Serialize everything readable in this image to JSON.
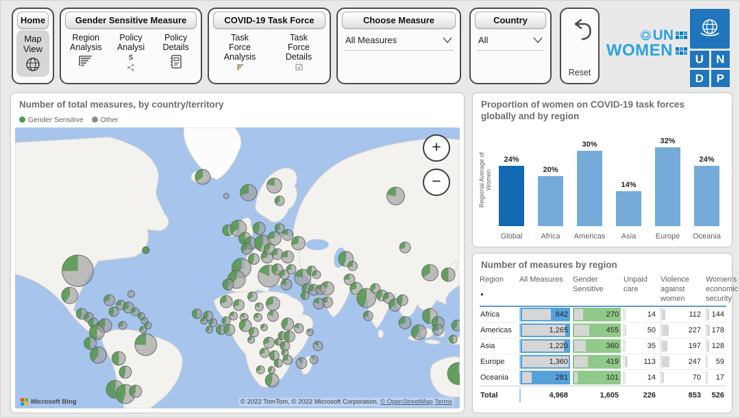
{
  "toolbar": {
    "home_label": "Home",
    "map_view_label": "Map View",
    "gender_group": {
      "title": "Gender Sensitive Measure",
      "items": [
        {
          "label": "Region Analysis",
          "icon": "bar-chart-icon"
        },
        {
          "label": "Policy Analysis",
          "icon": "share-icon"
        },
        {
          "label": "Policy Details",
          "icon": "notebook-icon"
        }
      ]
    },
    "covid_group": {
      "title": "COVID-19 Task Force",
      "items": [
        {
          "label": "Task Force Analysis",
          "icon": "funnel-icon"
        },
        {
          "label": "Task Force Details",
          "icon": "checkbox-icon"
        }
      ]
    },
    "measure_group": {
      "title": "Choose Measure",
      "value": "All Measures"
    },
    "country_group": {
      "title": "Country",
      "value": "All"
    },
    "reset_label": "Reset",
    "logos": {
      "un": "UN",
      "women": "WOMEN",
      "undp_letters": [
        "U",
        "N",
        "D",
        "P"
      ]
    }
  },
  "map": {
    "title": "Number of total measures, by country/territory",
    "legend": [
      {
        "label": "Gender Sensitive",
        "color": "#4c9b4e"
      },
      {
        "label": "Other",
        "color": "#8c8c8c"
      }
    ],
    "zoom_in_label": "+",
    "zoom_out_label": "−",
    "attribution_left": "Microsoft Bing",
    "attribution_right": "© 2022 TomTom, © 2022 Microsoft Corporation,",
    "link_osm": "© OpenStreetMap",
    "link_terms": "Terms",
    "bubbles": [
      [
        42.2,
        17.6,
        11,
        0.35
      ],
      [
        47.5,
        24.4,
        4,
        0
      ],
      [
        52.5,
        23.2,
        12,
        0.3
      ],
      [
        58.3,
        20.7,
        11,
        0.22
      ],
      [
        59.5,
        26.1,
        7,
        0.4
      ],
      [
        47.9,
        36.6,
        8,
        0.55
      ],
      [
        50.2,
        35.9,
        12,
        0.35
      ],
      [
        51.7,
        39.5,
        9,
        0.5
      ],
      [
        54.9,
        35.9,
        9,
        0.45
      ],
      [
        52.9,
        41.2,
        9,
        0.5
      ],
      [
        52.1,
        43.2,
        8,
        0.35
      ],
      [
        55.7,
        41.2,
        12,
        0.45
      ],
      [
        58.3,
        39.5,
        10,
        0.25
      ],
      [
        59.5,
        35.9,
        7,
        0.4
      ],
      [
        61.3,
        38.3,
        8,
        0.2
      ],
      [
        63.7,
        41.2,
        10,
        0.3
      ],
      [
        50.9,
        50.0,
        14,
        0.4
      ],
      [
        53.7,
        46.8,
        8,
        0.45
      ],
      [
        56.7,
        46.1,
        9,
        0.3
      ],
      [
        57.2,
        43.2,
        8,
        0.35
      ],
      [
        59.0,
        45.1,
        8,
        0.3
      ],
      [
        61.3,
        46.1,
        9,
        0.25
      ],
      [
        57.1,
        52.9,
        16,
        0.18
      ],
      [
        49.8,
        54.1,
        13,
        0.35
      ],
      [
        47.9,
        55.9,
        8,
        0.5
      ],
      [
        59.0,
        50.5,
        8,
        0.4
      ],
      [
        60.6,
        52.4,
        7,
        0.35
      ],
      [
        61.0,
        55.9,
        8,
        0.25
      ],
      [
        62.1,
        50.5,
        7,
        0.3
      ],
      [
        64.7,
        53.4,
        12,
        0.22
      ],
      [
        65.6,
        57.3,
        7,
        0.4
      ],
      [
        65.2,
        59.8,
        6,
        0.5
      ],
      [
        67.2,
        57.8,
        8,
        0.3
      ],
      [
        68.7,
        57.8,
        7,
        0.2
      ],
      [
        70.2,
        57.3,
        10,
        0.15
      ],
      [
        70.2,
        62.2,
        8,
        0.25
      ],
      [
        68.3,
        62.7,
        8,
        0.2
      ],
      [
        66.7,
        51.0,
        7,
        0.45
      ],
      [
        67.8,
        52.4,
        6,
        0.3
      ],
      [
        85.6,
        24.4,
        13,
        0.22
      ],
      [
        74.4,
        46.8,
        11,
        0.45
      ],
      [
        75.9,
        49.3,
        7,
        0.3
      ],
      [
        87.7,
        42.7,
        8,
        0.3
      ],
      [
        93.3,
        51.7,
        12,
        0.35
      ],
      [
        97.4,
        52.4,
        10,
        0.5
      ],
      [
        75.2,
        54.1,
        8,
        0.25
      ],
      [
        76.7,
        57.3,
        9,
        0.3
      ],
      [
        79.0,
        60.7,
        14,
        0.45
      ],
      [
        81.0,
        57.3,
        7,
        0.35
      ],
      [
        82.5,
        59.8,
        8,
        0.4
      ],
      [
        79.4,
        67.1,
        7,
        0.3
      ],
      [
        84.0,
        60.7,
        8,
        0.3
      ],
      [
        85.4,
        63.2,
        9,
        0.35
      ],
      [
        87.1,
        61.5,
        8,
        0.45
      ],
      [
        93.3,
        67.1,
        11,
        0.5
      ],
      [
        95.1,
        69.5,
        9,
        0.35
      ],
      [
        87.7,
        69.5,
        9,
        0.3
      ],
      [
        90.8,
        72.9,
        11,
        0.4
      ],
      [
        95.1,
        72.0,
        8,
        0.3
      ],
      [
        99.4,
        70.5,
        8,
        0.4
      ],
      [
        98.5,
        75.4,
        6,
        0.5
      ],
      [
        99.7,
        87.6,
        16,
        0.75
      ],
      [
        14.1,
        51.0,
        23,
        0.25
      ],
      [
        29.4,
        43.7,
        5,
        1.0
      ],
      [
        26.1,
        59.3,
        5,
        0
      ],
      [
        12.3,
        59.8,
        12,
        0.4
      ],
      [
        15.0,
        66.3,
        8,
        0.45
      ],
      [
        16.6,
        67.6,
        7,
        0.35
      ],
      [
        17.6,
        69.5,
        7,
        0.5
      ],
      [
        19.2,
        70.5,
        6,
        0.4
      ],
      [
        21.2,
        61.5,
        8,
        0.3
      ],
      [
        22.2,
        65.6,
        7,
        0.45
      ],
      [
        23.8,
        63.2,
        7,
        0.25
      ],
      [
        25.5,
        64.1,
        8,
        0.35
      ],
      [
        27.0,
        65.6,
        6,
        0.3
      ],
      [
        28.4,
        67.1,
        5,
        0.4
      ],
      [
        29.1,
        68.8,
        5,
        0.2
      ],
      [
        29.9,
        70.5,
        5,
        0.35
      ],
      [
        28.8,
        72.0,
        5,
        0.3
      ],
      [
        20.2,
        70.5,
        10,
        0.3
      ],
      [
        18.4,
        72.9,
        11,
        0.5
      ],
      [
        24.2,
        70.5,
        6,
        0.3
      ],
      [
        16.9,
        76.8,
        9,
        0.5
      ],
      [
        18.7,
        81.0,
        12,
        0.4
      ],
      [
        29.4,
        77.3,
        16,
        0.25
      ],
      [
        23.3,
        82.2,
        10,
        0.5
      ],
      [
        24.8,
        87.1,
        9,
        0.45
      ],
      [
        22.5,
        93.2,
        13,
        0.5
      ],
      [
        24.8,
        94.9,
        14,
        0.45
      ],
      [
        27.1,
        93.9,
        9,
        0.4
      ],
      [
        40.9,
        66.3,
        7,
        0.5
      ],
      [
        47.5,
        62.0,
        9,
        0.3
      ],
      [
        50.3,
        63.2,
        8,
        0.3
      ],
      [
        53.4,
        60.2,
        7,
        0.35
      ],
      [
        54.9,
        63.9,
        6,
        0.2
      ],
      [
        58.0,
        62.7,
        10,
        0.3
      ],
      [
        43.4,
        67.1,
        7,
        0.4
      ],
      [
        42.5,
        68.8,
        5,
        0.3
      ],
      [
        44.5,
        69.5,
        6,
        0.4
      ],
      [
        43.7,
        72.0,
        5,
        0.35
      ],
      [
        46.3,
        72.0,
        7,
        0.5
      ],
      [
        48.2,
        72.0,
        8,
        0.4
      ],
      [
        47.5,
        68.8,
        6,
        0.4
      ],
      [
        49.1,
        67.1,
        6,
        0.25
      ],
      [
        51.5,
        67.6,
        6,
        0.2
      ],
      [
        51.8,
        70.5,
        9,
        0.4
      ],
      [
        54.6,
        67.6,
        6,
        0.25
      ],
      [
        58.0,
        67.1,
        8,
        0.2
      ],
      [
        61.3,
        70.0,
        9,
        0.4
      ],
      [
        63.8,
        71.5,
        7,
        0.2
      ],
      [
        53.7,
        72.9,
        7,
        0.4
      ],
      [
        56.0,
        71.2,
        5,
        0.3
      ],
      [
        60.1,
        74.1,
        6,
        0.5
      ],
      [
        61.7,
        74.4,
        8,
        0.5
      ],
      [
        57.1,
        76.6,
        8,
        0.3
      ],
      [
        53.1,
        75.6,
        5,
        0.3
      ],
      [
        59.2,
        76.3,
        5,
        0.5
      ],
      [
        60.7,
        77.8,
        7,
        0.4
      ],
      [
        66.3,
        72.9,
        5,
        0.2
      ],
      [
        56.1,
        80.2,
        7,
        0.3
      ],
      [
        58.3,
        81.2,
        7,
        0.5
      ],
      [
        60.7,
        80.2,
        5,
        0.4
      ],
      [
        59.2,
        83.9,
        6,
        0.5
      ],
      [
        61.3,
        82.7,
        7,
        0.3
      ],
      [
        64.4,
        83.9,
        8,
        0.1
      ],
      [
        68.1,
        77.8,
        7,
        0.15
      ],
      [
        67.2,
        82.7,
        6,
        0.1
      ],
      [
        55.2,
        86.3,
        6,
        0.3
      ],
      [
        57.7,
        86.3,
        5,
        0.4
      ],
      [
        57.8,
        90.0,
        10,
        0.45
      ]
    ]
  },
  "chart_data": {
    "type": "bar",
    "title": "Proportion of women on COVID-19 task forces globally and by region",
    "ylabel": "Regional Average of Women",
    "xlabel": "",
    "categories": [
      "Global",
      "Africa",
      "Americas",
      "Asia",
      "Europe",
      "Oceania"
    ],
    "values": [
      24,
      20,
      30,
      14,
      32,
      24
    ],
    "labels": [
      "24%",
      "20%",
      "30%",
      "14%",
      "32%",
      "24%"
    ],
    "bar_colors": [
      "#1268b1",
      "#74abd9",
      "#74abd9",
      "#74abd9",
      "#74abd9",
      "#74abd9"
    ],
    "ylim": [
      0,
      35
    ],
    "grid": false,
    "legend_position": "none"
  },
  "table": {
    "title": "Number of measures by region",
    "columns": [
      "Region",
      "All Measures",
      "Gender Sensitive",
      "Unpaid care",
      "Violence against women",
      "Women's economic security"
    ],
    "sort_indicator": "▲",
    "bar_max": 1360,
    "rows": [
      {
        "region": "Africa",
        "display": [
          "842",
          "270",
          "14",
          "112",
          "144"
        ],
        "numeric": [
          842,
          270,
          14,
          112,
          144
        ]
      },
      {
        "region": "Americas",
        "display": [
          "1,265",
          "455",
          "50",
          "227",
          "178"
        ],
        "numeric": [
          1265,
          455,
          50,
          227,
          178
        ]
      },
      {
        "region": "Asia",
        "display": [
          "1,220",
          "360",
          "35",
          "197",
          "128"
        ],
        "numeric": [
          1220,
          360,
          35,
          197,
          128
        ]
      },
      {
        "region": "Europe",
        "display": [
          "1,360",
          "419",
          "113",
          "247",
          "59"
        ],
        "numeric": [
          1360,
          419,
          113,
          247,
          59
        ]
      },
      {
        "region": "Oceania",
        "display": [
          "281",
          "101",
          "14",
          "70",
          "17"
        ],
        "numeric": [
          281,
          101,
          14,
          70,
          17
        ]
      }
    ],
    "total": {
      "region": "Total",
      "display": [
        "4,968",
        "1,605",
        "226",
        "853",
        "526"
      ]
    }
  }
}
